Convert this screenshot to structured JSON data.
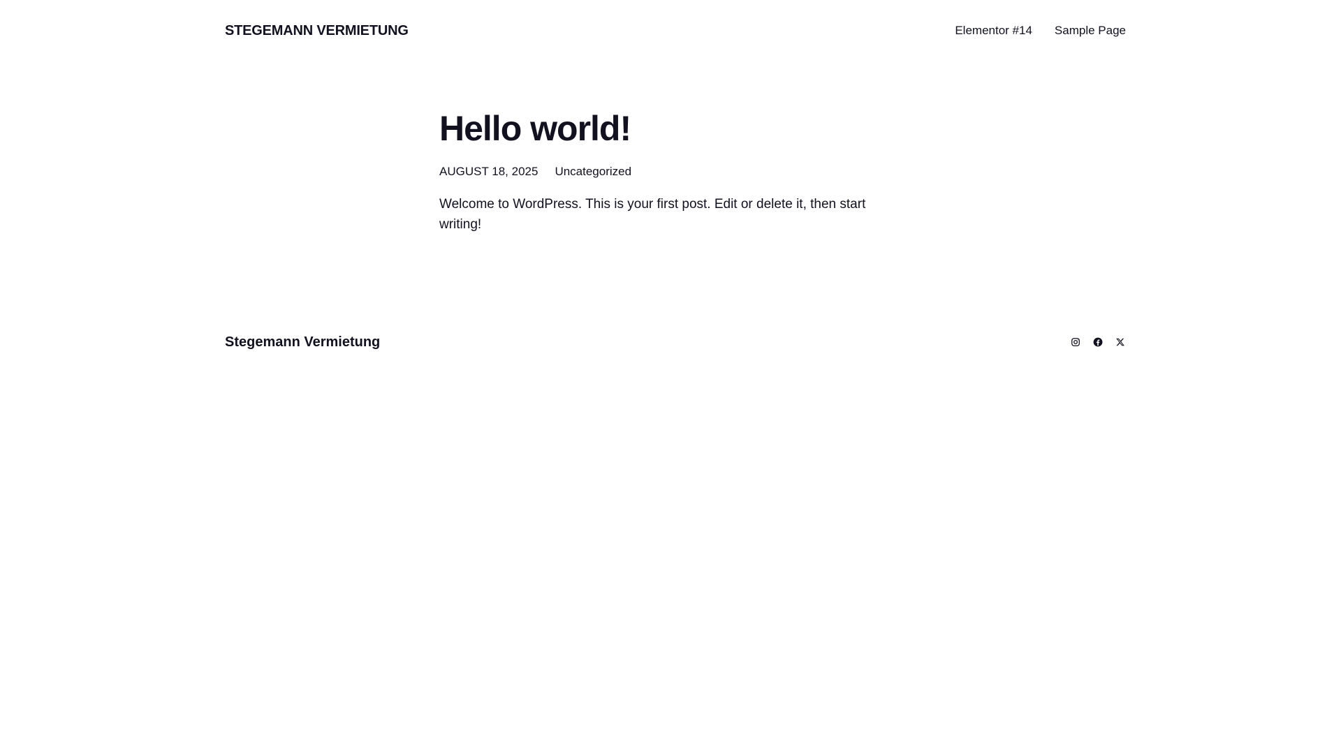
{
  "header": {
    "site_title": "STEGEMANN VERMIETUNG",
    "nav": [
      {
        "label": "Elementor #14"
      },
      {
        "label": "Sample Page"
      }
    ]
  },
  "post": {
    "title": "Hello world!",
    "date": "AUGUST 18, 2025",
    "category": "Uncategorized",
    "content": "Welcome to WordPress. This is your first post. Edit or delete it, then start writing!"
  },
  "footer": {
    "site_title": "Stegemann Vermietung",
    "social": [
      {
        "icon": "instagram-icon"
      },
      {
        "icon": "facebook-icon"
      },
      {
        "icon": "x-icon"
      }
    ]
  },
  "colors": {
    "text": "#11111f",
    "background": "#ffffff"
  }
}
